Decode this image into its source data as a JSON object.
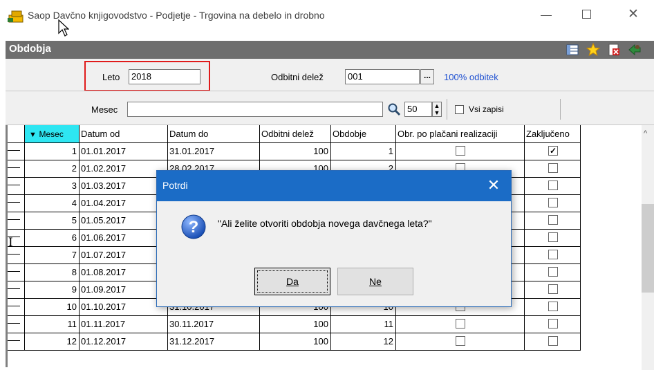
{
  "window": {
    "title": "Saop Davčno knjigovodstvo - Podjetje - Trgovina na debelo in drobno",
    "minimize_icon": "minimize-icon",
    "maximize_icon": "maximize-icon",
    "close_icon": "close-icon",
    "close_glyph": "✕"
  },
  "panel": {
    "title": "Obdobja",
    "icons": [
      "columns-icon",
      "star-icon",
      "delete-icon",
      "exit-icon"
    ]
  },
  "filters": {
    "leto_label": "Leto",
    "leto_value": "2018",
    "odbitni_delez_label": "Odbitni delež",
    "odbitni_delez_value": "001",
    "dots_label": "...",
    "odbitek_text": "100% odbitek",
    "mesec_label": "Mesec",
    "mesec_value": "",
    "count_value": "50",
    "vsi_zapisi_label": "Vsi zapisi",
    "vsi_zapisi_checked": false
  },
  "grid": {
    "columns": [
      "Mesec",
      "Datum od",
      "Datum do",
      "Odbitni delež",
      "Obdobje",
      "Obr. po plačani realizaciji",
      "Zaključeno"
    ],
    "sort_indicator": "▼",
    "rows": [
      {
        "mesec": "1",
        "datum_od": "01.01.2017",
        "datum_do": "31.01.2017",
        "odbitni": "100",
        "obdobje": "1",
        "obr": false,
        "zakljuceno": true
      },
      {
        "mesec": "2",
        "datum_od": "01.02.2017",
        "datum_do": "28.02.2017",
        "odbitni": "100",
        "obdobje": "2",
        "obr": false,
        "zakljuceno": false
      },
      {
        "mesec": "3",
        "datum_od": "01.03.2017",
        "datum_do": "",
        "odbitni": "",
        "obdobje": "",
        "obr": false,
        "zakljuceno": false
      },
      {
        "mesec": "4",
        "datum_od": "01.04.2017",
        "datum_do": "",
        "odbitni": "",
        "obdobje": "",
        "obr": false,
        "zakljuceno": false
      },
      {
        "mesec": "5",
        "datum_od": "01.05.2017",
        "datum_do": "",
        "odbitni": "",
        "obdobje": "",
        "obr": false,
        "zakljuceno": false
      },
      {
        "mesec": "6",
        "datum_od": "01.06.2017",
        "datum_do": "",
        "odbitni": "",
        "obdobje": "",
        "obr": false,
        "zakljuceno": false
      },
      {
        "mesec": "7",
        "datum_od": "01.07.2017",
        "datum_do": "",
        "odbitni": "",
        "obdobje": "",
        "obr": false,
        "zakljuceno": false
      },
      {
        "mesec": "8",
        "datum_od": "01.08.2017",
        "datum_do": "",
        "odbitni": "",
        "obdobje": "",
        "obr": false,
        "zakljuceno": false
      },
      {
        "mesec": "9",
        "datum_od": "01.09.2017",
        "datum_do": "",
        "odbitni": "",
        "obdobje": "",
        "obr": false,
        "zakljuceno": false
      },
      {
        "mesec": "10",
        "datum_od": "01.10.2017",
        "datum_do": "31.10.2017",
        "odbitni": "100",
        "obdobje": "10",
        "obr": false,
        "zakljuceno": false
      },
      {
        "mesec": "11",
        "datum_od": "01.11.2017",
        "datum_do": "30.11.2017",
        "odbitni": "100",
        "obdobje": "11",
        "obr": false,
        "zakljuceno": false
      },
      {
        "mesec": "12",
        "datum_od": "01.12.2017",
        "datum_do": "31.12.2017",
        "odbitni": "100",
        "obdobje": "12",
        "obr": false,
        "zakljuceno": false
      }
    ],
    "scroll_up_glyph": "^"
  },
  "dialog": {
    "title": "Potrdi",
    "close_glyph": "✕",
    "message": "\"Ali želite otvoriti obdobja novega davčnega leta?\"",
    "icon": "question-icon",
    "yes_label": "Da",
    "no_label": "Ne"
  },
  "colors": {
    "highlight_box": "#e01b1b",
    "dialog_titlebar": "#1b6cc6",
    "header_bar": "#6e6e6e",
    "sorted_column": "#2ee6f2",
    "link_blue": "#1d4fd1"
  }
}
